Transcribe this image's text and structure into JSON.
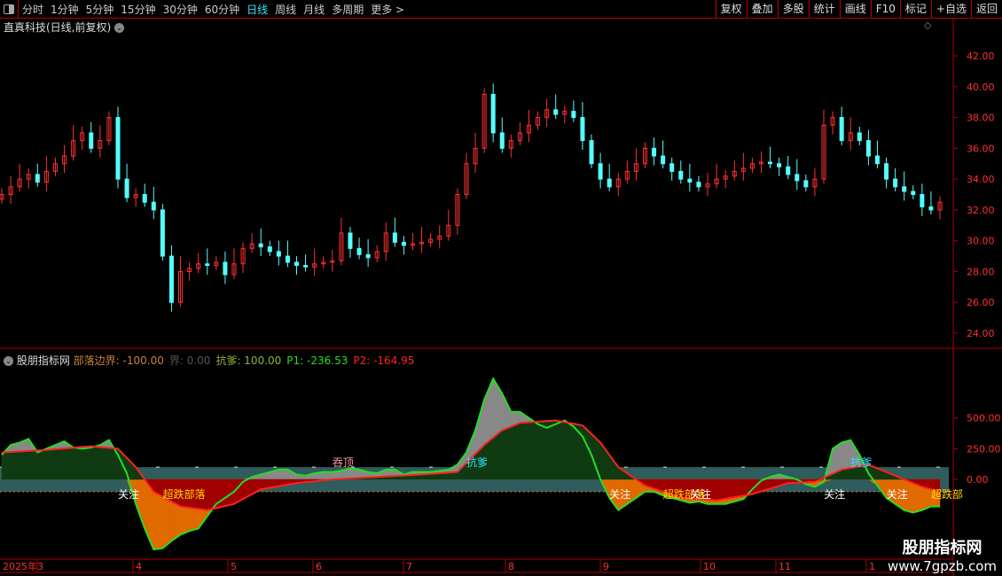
{
  "toolbar": {
    "periods": [
      "分时",
      "1分钟",
      "5分钟",
      "15分钟",
      "30分钟",
      "60分钟",
      "日线",
      "周线",
      "月线",
      "多周期",
      "更多 >"
    ],
    "selected": "日线",
    "right_buttons": [
      "复权",
      "叠加",
      "多股",
      "统计",
      "画线",
      "F10",
      "标记",
      "+自选",
      "返回"
    ]
  },
  "main": {
    "title": "直真科技(日线,前复权)",
    "price_ticks": [
      "42.00",
      "40.00",
      "38.00",
      "36.00",
      "34.00",
      "32.00",
      "30.00",
      "28.00",
      "26.00",
      "24.00"
    ]
  },
  "indicator": {
    "name": "股朋指标网",
    "values": [
      {
        "label": "部落边界:",
        "value": "-100.00",
        "color": "#c8843c"
      },
      {
        "label": "界:",
        "value": "0.00",
        "color": "#555555"
      },
      {
        "label": "抗爹:",
        "value": "100.00",
        "color": "#8fb33a"
      },
      {
        "label": "P1:",
        "value": "-236.53",
        "color": "#22e022"
      },
      {
        "label": "P2:",
        "value": "-164.95",
        "color": "#ff2020"
      }
    ],
    "ticks": [
      "500.00",
      "250.00",
      "0.00"
    ],
    "labels": [
      {
        "t": "关注",
        "c": "#ffffff",
        "i": 14
      },
      {
        "t": "超跌部落",
        "c": "#ffd700",
        "i": 19
      },
      {
        "t": "吞顶",
        "c": "#ff9999",
        "i": 38
      },
      {
        "t": "抗爹",
        "c": "#2ee6ff",
        "i": 53
      },
      {
        "t": "关注",
        "c": "#ffffff",
        "i": 69
      },
      {
        "t": "超跌部落",
        "c": "#ffd700",
        "i": 75
      },
      {
        "t": "关注",
        "c": "#ffffff",
        "i": 78
      },
      {
        "t": "关注",
        "c": "#ffffff",
        "i": 93
      },
      {
        "t": "抗爹",
        "c": "#2ee6ff",
        "i": 96
      },
      {
        "t": "关注",
        "c": "#ffffff",
        "i": 100
      },
      {
        "t": "超跌部",
        "c": "#ffd700",
        "i": 105
      }
    ]
  },
  "time_axis": [
    "2025年3",
    "4",
    "5",
    "6",
    "7",
    "8",
    "9",
    "10",
    "11",
    "1"
  ],
  "chart_data": {
    "type": "candlestick+line",
    "closes": [
      33,
      33.5,
      34,
      34.3,
      33.8,
      34.5,
      35,
      35.5,
      36.5,
      37,
      36,
      36.5,
      38,
      34,
      32.8,
      33,
      32.5,
      32,
      29,
      26,
      28,
      28.2,
      28.5,
      28.4,
      28.6,
      27.8,
      28.5,
      29.5,
      29.8,
      29.6,
      29.3,
      29,
      28.6,
      28.4,
      28.3,
      28.5,
      28.6,
      28.7,
      30.5,
      29.5,
      29.1,
      28.9,
      29.3,
      30.5,
      29.9,
      29.7,
      29.8,
      29.9,
      30.1,
      30.3,
      31,
      33,
      35,
      36,
      39.5,
      37,
      36,
      36.5,
      37,
      37.5,
      38,
      38.5,
      38.2,
      38.4,
      38,
      36.5,
      35,
      34,
      33.5,
      34,
      34.5,
      35,
      36,
      35.5,
      35,
      34.5,
      34,
      33.8,
      33.5,
      33.7,
      34,
      34.2,
      34.5,
      34.7,
      35,
      35.1,
      35,
      34.8,
      34.3,
      33.9,
      33.5,
      34,
      37.5,
      38,
      36.5,
      37,
      36.5,
      35.5,
      35,
      34,
      33.5,
      33.2,
      33,
      32.2,
      32,
      32.5
    ],
    "ylim": [
      24,
      42
    ],
    "P1": [
      200,
      280,
      300,
      330,
      220,
      250,
      280,
      310,
      260,
      250,
      260,
      280,
      320,
      200,
      50,
      -200,
      -400,
      -570,
      -560,
      -500,
      -450,
      -420,
      -400,
      -300,
      -200,
      -150,
      -100,
      -20,
      20,
      40,
      60,
      80,
      80,
      40,
      30,
      50,
      60,
      60,
      70,
      90,
      80,
      60,
      50,
      80,
      80,
      40,
      60,
      60,
      60,
      70,
      80,
      120,
      220,
      400,
      650,
      820,
      700,
      550,
      550,
      500,
      450,
      420,
      450,
      480,
      430,
      350,
      200,
      0,
      -150,
      -250,
      -200,
      -150,
      -100,
      -100,
      -130,
      -150,
      -170,
      -190,
      -180,
      -200,
      -200,
      -200,
      -180,
      -160,
      -80,
      -10,
      20,
      40,
      20,
      0,
      -40,
      -60,
      -20,
      250,
      300,
      320,
      200,
      50,
      -50,
      -150,
      -200,
      -250,
      -270,
      -250,
      -220,
      -220
    ],
    "P2_keypoints": [
      [
        0,
        220
      ],
      [
        5,
        240
      ],
      [
        10,
        270
      ],
      [
        13,
        250
      ],
      [
        15,
        100
      ],
      [
        17,
        -100
      ],
      [
        20,
        -220
      ],
      [
        23,
        -250
      ],
      [
        26,
        -200
      ],
      [
        29,
        -80
      ],
      [
        33,
        -30
      ],
      [
        37,
        0
      ],
      [
        42,
        20
      ],
      [
        47,
        40
      ],
      [
        51,
        60
      ],
      [
        54,
        280
      ],
      [
        56,
        400
      ],
      [
        58,
        460
      ],
      [
        62,
        480
      ],
      [
        65,
        440
      ],
      [
        67,
        300
      ],
      [
        69,
        100
      ],
      [
        72,
        -50
      ],
      [
        76,
        -150
      ],
      [
        80,
        -170
      ],
      [
        84,
        -120
      ],
      [
        88,
        -30
      ],
      [
        91,
        -20
      ],
      [
        94,
        80
      ],
      [
        97,
        120
      ],
      [
        100,
        30
      ],
      [
        103,
        -60
      ],
      [
        105,
        -100
      ]
    ],
    "band": [
      -100,
      100
    ],
    "ylim_indicator": [
      -620,
      900
    ]
  },
  "colors": {
    "up": "#ff3030",
    "down": "#54ffff",
    "border": "#b00000"
  },
  "logo": {
    "name": "股朋指标网",
    "url": "www.7gpzb.com"
  }
}
